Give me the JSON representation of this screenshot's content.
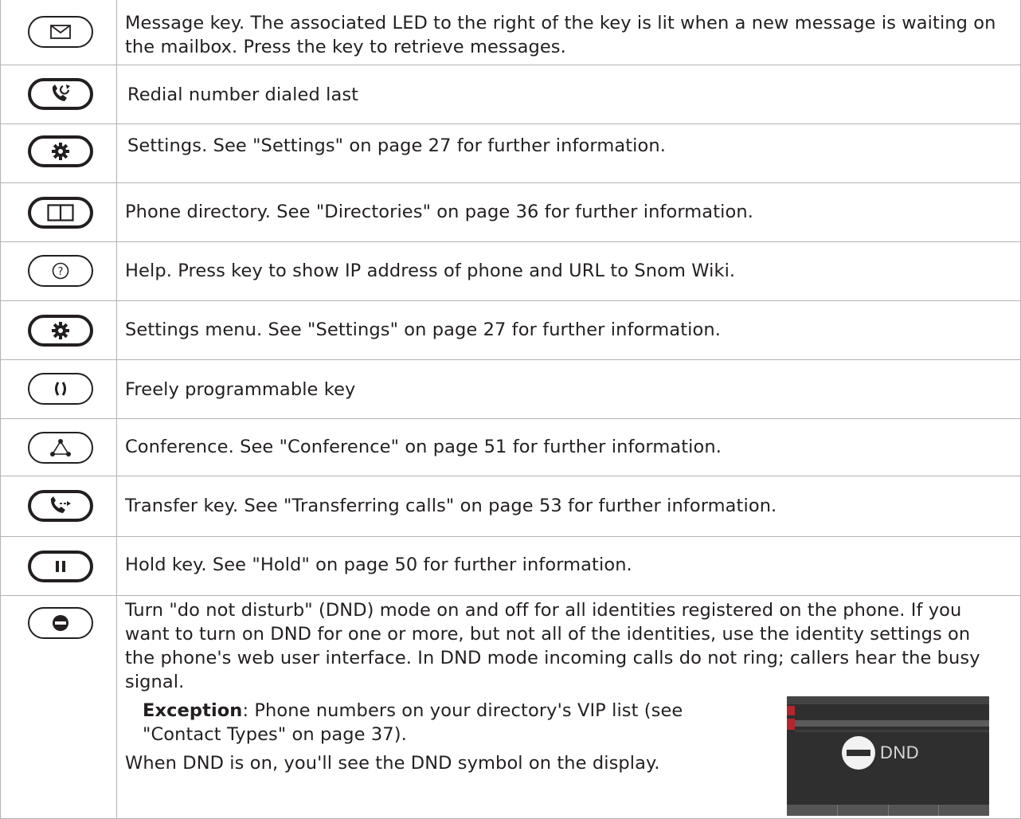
{
  "rows": [
    {
      "icon": "envelope-icon",
      "text": "Message key.  The associated LED to the right of the key is lit when a new message is waiting on the mailbox.  Press the key to retrieve messages."
    },
    {
      "icon": "redial-phone-icon",
      "text": "Redial number dialed last"
    },
    {
      "icon": "gear-icon",
      "text": "Settings.  See \"Settings\" on page 27 for further information."
    },
    {
      "icon": "book-icon",
      "text": "Phone directory.  See \"Directories\" on page 36 for further information."
    },
    {
      "icon": "help-question-icon",
      "text": "Help.  Press key to show IP address of phone and URL to Snom Wiki."
    },
    {
      "icon": "gear-icon",
      "text": "Settings menu.  See \"Settings\" on page 27 for further information."
    },
    {
      "icon": "programmable-key-icon",
      "text": "Freely programmable key"
    },
    {
      "icon": "conference-triangle-icon",
      "text": "Conference.  See \"Conference\" on page 51 for further information."
    },
    {
      "icon": "transfer-phone-icon",
      "text": "Transfer key.  See \"Transferring calls\" on page 53 for further information."
    },
    {
      "icon": "pause-icon",
      "text": "Hold key.  See \"Hold\" on page 50 for further information."
    }
  ],
  "dnd": {
    "icon": "dnd-minus-icon",
    "text": "Turn \"do not disturb\" (DND) mode on and off for all identities registered on the phone.  If you want to turn on DND for one or more, but not all of the identities, use the identity settings on the phone's web user interface.  In DND mode incoming calls do not ring; callers hear the busy signal.",
    "exception_label": "Exception",
    "exception_text": ":  Phone numbers on your directory's VIP list (see \"Contact Types\" on page 37).",
    "note": "When DND is on, you'll see the DND symbol on the display.",
    "screen_label": "DND"
  }
}
